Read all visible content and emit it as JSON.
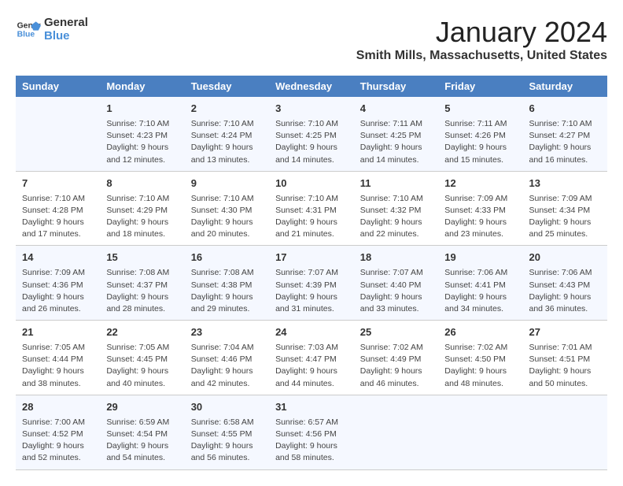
{
  "logo": {
    "line1": "General",
    "line2": "Blue"
  },
  "title": "January 2024",
  "location": "Smith Mills, Massachusetts, United States",
  "days_of_week": [
    "Sunday",
    "Monday",
    "Tuesday",
    "Wednesday",
    "Thursday",
    "Friday",
    "Saturday"
  ],
  "weeks": [
    [
      {
        "day": "",
        "info": ""
      },
      {
        "day": "1",
        "info": "Sunrise: 7:10 AM\nSunset: 4:23 PM\nDaylight: 9 hours\nand 12 minutes."
      },
      {
        "day": "2",
        "info": "Sunrise: 7:10 AM\nSunset: 4:24 PM\nDaylight: 9 hours\nand 13 minutes."
      },
      {
        "day": "3",
        "info": "Sunrise: 7:10 AM\nSunset: 4:25 PM\nDaylight: 9 hours\nand 14 minutes."
      },
      {
        "day": "4",
        "info": "Sunrise: 7:11 AM\nSunset: 4:25 PM\nDaylight: 9 hours\nand 14 minutes."
      },
      {
        "day": "5",
        "info": "Sunrise: 7:11 AM\nSunset: 4:26 PM\nDaylight: 9 hours\nand 15 minutes."
      },
      {
        "day": "6",
        "info": "Sunrise: 7:10 AM\nSunset: 4:27 PM\nDaylight: 9 hours\nand 16 minutes."
      }
    ],
    [
      {
        "day": "7",
        "info": "Sunrise: 7:10 AM\nSunset: 4:28 PM\nDaylight: 9 hours\nand 17 minutes."
      },
      {
        "day": "8",
        "info": "Sunrise: 7:10 AM\nSunset: 4:29 PM\nDaylight: 9 hours\nand 18 minutes."
      },
      {
        "day": "9",
        "info": "Sunrise: 7:10 AM\nSunset: 4:30 PM\nDaylight: 9 hours\nand 20 minutes."
      },
      {
        "day": "10",
        "info": "Sunrise: 7:10 AM\nSunset: 4:31 PM\nDaylight: 9 hours\nand 21 minutes."
      },
      {
        "day": "11",
        "info": "Sunrise: 7:10 AM\nSunset: 4:32 PM\nDaylight: 9 hours\nand 22 minutes."
      },
      {
        "day": "12",
        "info": "Sunrise: 7:09 AM\nSunset: 4:33 PM\nDaylight: 9 hours\nand 23 minutes."
      },
      {
        "day": "13",
        "info": "Sunrise: 7:09 AM\nSunset: 4:34 PM\nDaylight: 9 hours\nand 25 minutes."
      }
    ],
    [
      {
        "day": "14",
        "info": "Sunrise: 7:09 AM\nSunset: 4:36 PM\nDaylight: 9 hours\nand 26 minutes."
      },
      {
        "day": "15",
        "info": "Sunrise: 7:08 AM\nSunset: 4:37 PM\nDaylight: 9 hours\nand 28 minutes."
      },
      {
        "day": "16",
        "info": "Sunrise: 7:08 AM\nSunset: 4:38 PM\nDaylight: 9 hours\nand 29 minutes."
      },
      {
        "day": "17",
        "info": "Sunrise: 7:07 AM\nSunset: 4:39 PM\nDaylight: 9 hours\nand 31 minutes."
      },
      {
        "day": "18",
        "info": "Sunrise: 7:07 AM\nSunset: 4:40 PM\nDaylight: 9 hours\nand 33 minutes."
      },
      {
        "day": "19",
        "info": "Sunrise: 7:06 AM\nSunset: 4:41 PM\nDaylight: 9 hours\nand 34 minutes."
      },
      {
        "day": "20",
        "info": "Sunrise: 7:06 AM\nSunset: 4:43 PM\nDaylight: 9 hours\nand 36 minutes."
      }
    ],
    [
      {
        "day": "21",
        "info": "Sunrise: 7:05 AM\nSunset: 4:44 PM\nDaylight: 9 hours\nand 38 minutes."
      },
      {
        "day": "22",
        "info": "Sunrise: 7:05 AM\nSunset: 4:45 PM\nDaylight: 9 hours\nand 40 minutes."
      },
      {
        "day": "23",
        "info": "Sunrise: 7:04 AM\nSunset: 4:46 PM\nDaylight: 9 hours\nand 42 minutes."
      },
      {
        "day": "24",
        "info": "Sunrise: 7:03 AM\nSunset: 4:47 PM\nDaylight: 9 hours\nand 44 minutes."
      },
      {
        "day": "25",
        "info": "Sunrise: 7:02 AM\nSunset: 4:49 PM\nDaylight: 9 hours\nand 46 minutes."
      },
      {
        "day": "26",
        "info": "Sunrise: 7:02 AM\nSunset: 4:50 PM\nDaylight: 9 hours\nand 48 minutes."
      },
      {
        "day": "27",
        "info": "Sunrise: 7:01 AM\nSunset: 4:51 PM\nDaylight: 9 hours\nand 50 minutes."
      }
    ],
    [
      {
        "day": "28",
        "info": "Sunrise: 7:00 AM\nSunset: 4:52 PM\nDaylight: 9 hours\nand 52 minutes."
      },
      {
        "day": "29",
        "info": "Sunrise: 6:59 AM\nSunset: 4:54 PM\nDaylight: 9 hours\nand 54 minutes."
      },
      {
        "day": "30",
        "info": "Sunrise: 6:58 AM\nSunset: 4:55 PM\nDaylight: 9 hours\nand 56 minutes."
      },
      {
        "day": "31",
        "info": "Sunrise: 6:57 AM\nSunset: 4:56 PM\nDaylight: 9 hours\nand 58 minutes."
      },
      {
        "day": "",
        "info": ""
      },
      {
        "day": "",
        "info": ""
      },
      {
        "day": "",
        "info": ""
      }
    ]
  ]
}
